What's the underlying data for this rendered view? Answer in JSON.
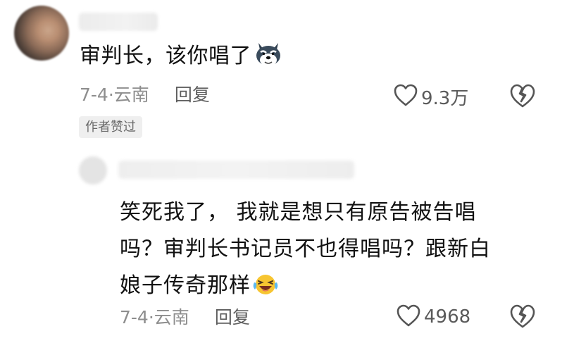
{
  "comment1": {
    "text": "审判长，该你唱了",
    "emoji": "wolf-face-emoji",
    "date": "7-4",
    "separator": "·",
    "location": "云南",
    "reply_label": "回复",
    "likes": "9.3万",
    "badge": "作者赞过"
  },
  "comment2": {
    "lines": [
      "笑死我了， 我就是想只有原告被告唱",
      "吗？审判长书记员不也得唱吗？跟新白",
      "娘子传奇那样"
    ],
    "emoji": "laughing-tears-emoji",
    "date": "7-4",
    "separator": "·",
    "location": "云南",
    "reply_label": "回复",
    "likes": "4968"
  },
  "colors": {
    "text": "#111111",
    "meta": "#8e8e8e",
    "icon": "#555555",
    "badge_bg": "#efefef"
  },
  "icons": [
    "heart-icon",
    "broken-heart-icon"
  ]
}
